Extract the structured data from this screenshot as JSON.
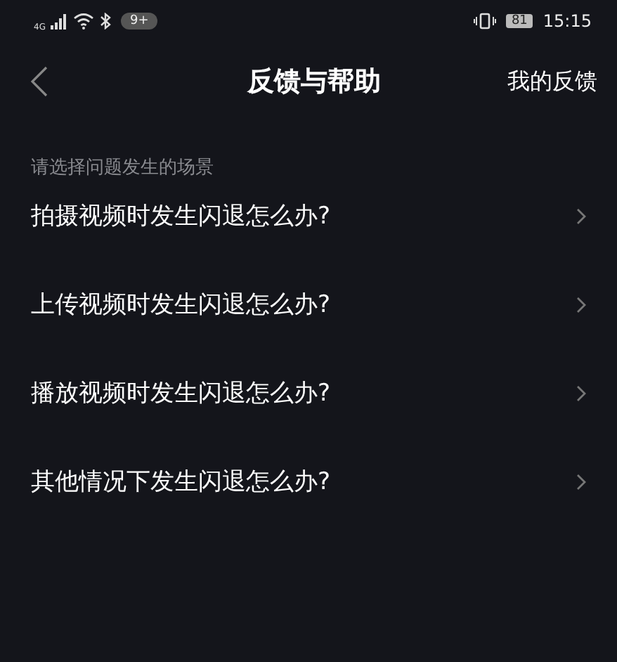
{
  "status_bar": {
    "network": "4G",
    "notification_badge": "9+",
    "battery": "81",
    "time": "15:15"
  },
  "nav": {
    "title": "反馈与帮助",
    "action": "我的反馈"
  },
  "section_label": "请选择问题发生的场景",
  "items": [
    {
      "label": "拍摄视频时发生闪退怎么办?"
    },
    {
      "label": "上传视频时发生闪退怎么办?"
    },
    {
      "label": "播放视频时发生闪退怎么办?"
    },
    {
      "label": "其他情况下发生闪退怎么办?"
    }
  ]
}
